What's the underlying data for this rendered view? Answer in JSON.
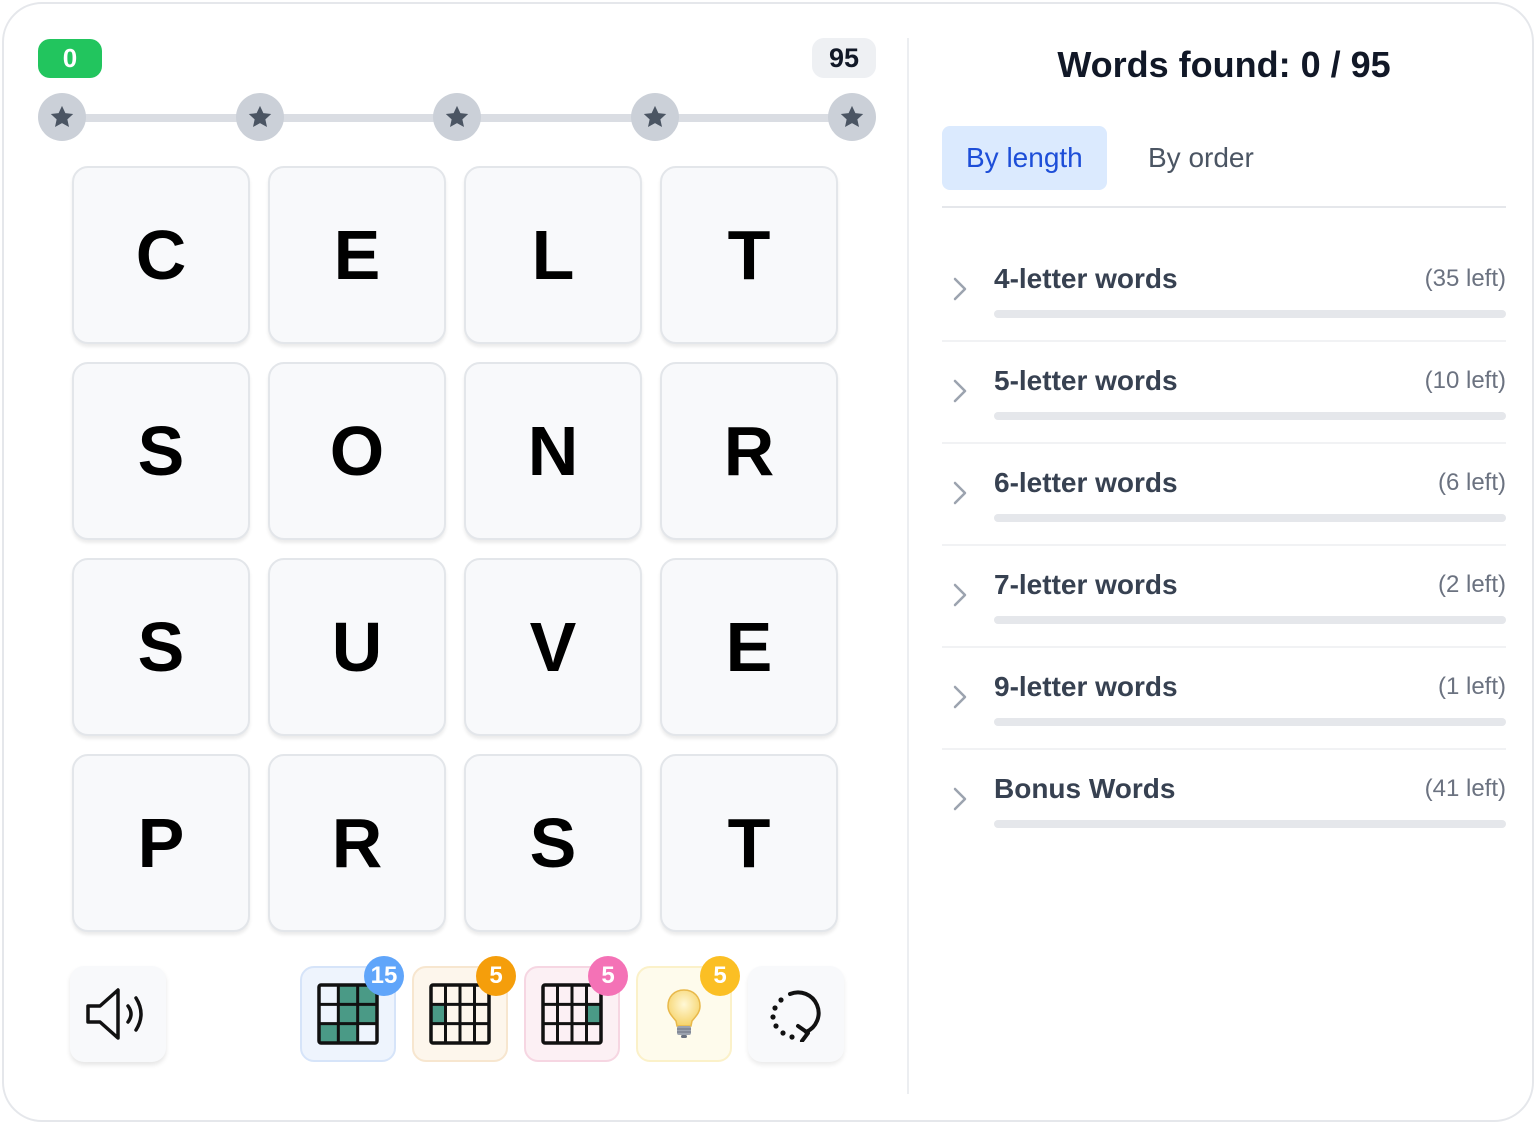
{
  "progress": {
    "start_score": "0",
    "max_score": "95",
    "current": 0
  },
  "stars": [
    "star-1",
    "star-2",
    "star-3",
    "star-4",
    "star-5"
  ],
  "board": {
    "tiles": [
      "C",
      "E",
      "L",
      "T",
      "S",
      "O",
      "N",
      "R",
      "S",
      "U",
      "V",
      "E",
      "P",
      "R",
      "S",
      "T"
    ]
  },
  "toolbar": {
    "sound_icon": "speaker-icon",
    "grid1_count": "15",
    "grid2_count": "5",
    "grid3_count": "5",
    "hint_count": "5",
    "hint_icon": "lightbulb-icon",
    "reset_icon": "reset-icon"
  },
  "colors": {
    "badge_blue": "#60a5fa",
    "badge_orange": "#f59e0b",
    "badge_pink": "#f472b6",
    "badge_yellow": "#fbbf24",
    "tile_fill": "#4a9a86",
    "accent_green": "#22c55e"
  },
  "words_panel": {
    "title": "Words found: 0 / 95",
    "tabs": [
      "By length",
      "By order"
    ],
    "groups": [
      {
        "label": "4-letter words",
        "left": "(35 left)"
      },
      {
        "label": "5-letter words",
        "left": "(10 left)"
      },
      {
        "label": "6-letter words",
        "left": "(6 left)"
      },
      {
        "label": "7-letter words",
        "left": "(2 left)"
      },
      {
        "label": "9-letter words",
        "left": "(1 left)"
      },
      {
        "label": "Bonus Words",
        "left": "(41 left)"
      }
    ]
  }
}
